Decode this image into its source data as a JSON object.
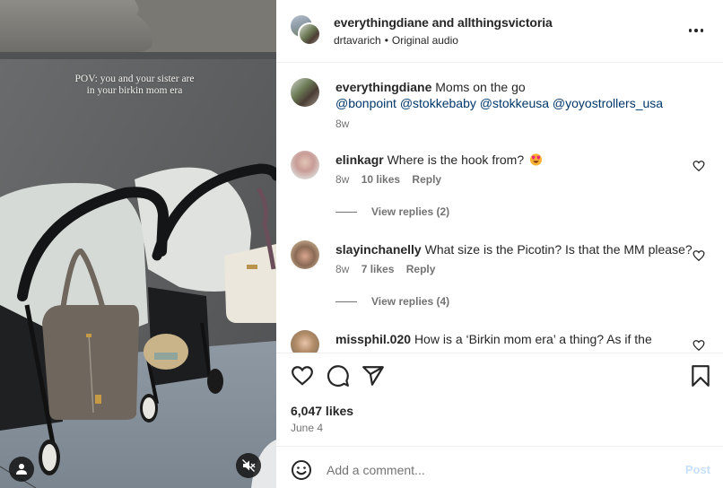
{
  "media": {
    "overlay_text_lines": [
      "POV: you and your sister are",
      "in your birkin mom era"
    ],
    "tag_button_icon": "person-icon",
    "mute_button_icon": "speaker-muted-icon"
  },
  "header": {
    "title": "everythingdiane and allthingsvictoria",
    "audio_author": "drtavarich",
    "separator": "•",
    "audio_label": "Original audio",
    "more_icon": "more-horizontal-icon"
  },
  "caption": {
    "username": "everythingdiane",
    "text": "Moms on the go",
    "mentions": [
      "@bonpoint",
      "@stokkebaby",
      "@stokkeusa",
      "@yoyostrollers_usa"
    ],
    "time": "8w"
  },
  "comments": [
    {
      "username": "elinkagr",
      "text": "Where is the hook from?",
      "emoji": "smiling-face-with-heart-eyes",
      "time": "8w",
      "likes": "10 likes",
      "reply_label": "Reply",
      "view_replies": "View replies (2)"
    },
    {
      "username": "slayinchanelly",
      "text": "What size is the Picotin? Is that the MM please?",
      "time": "8w",
      "likes": "7 likes",
      "reply_label": "Reply",
      "view_replies": "View replies (4)"
    },
    {
      "username": "missphil.020",
      "text": "How is a ‘Birkin mom era’ a thing? As if the"
    }
  ],
  "actions": {
    "like_icon": "heart-icon",
    "comment_icon": "comment-icon",
    "share_icon": "paper-plane-icon",
    "save_icon": "bookmark-icon",
    "likes": "6,047 likes",
    "date": "June 4"
  },
  "add_comment": {
    "placeholder": "Add a comment...",
    "value": "",
    "post_label": "Post",
    "post_color": "#c7e0fd"
  },
  "colors": {
    "primary_text": "#262626",
    "secondary_text": "#737373",
    "mention": "#00376b",
    "divider": "#efefef"
  }
}
